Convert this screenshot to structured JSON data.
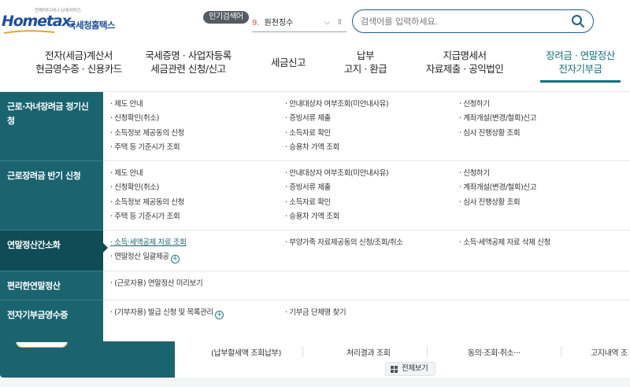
{
  "header": {
    "logo": {
      "tagline": "언제어디서나 납세서비스",
      "wordmark": "Hometax.",
      "title": "국세청홈택스"
    },
    "popular": {
      "badge": "인기검색어",
      "rank": "9.",
      "keyword": "원천징수",
      "chevron": "⌵",
      "pause": "II"
    },
    "search": {
      "placeholder": "검색어를 입력하세요."
    }
  },
  "nav": [
    {
      "line1": "전자(세금)계산서",
      "line2": "현금영수증 · 신용카드"
    },
    {
      "line1": "국세증명 · 사업자등록",
      "line2": "세금관련 신청/신고"
    },
    {
      "line1": "세금신고",
      "line2": ""
    },
    {
      "line1": "납부",
      "line2": "고지 · 환급"
    },
    {
      "line1": "지급명세서",
      "line2": "자료제출 · 공익법인"
    },
    {
      "line1": "장려금 · 연말정산",
      "line2": "전자기부금"
    }
  ],
  "dropdown": {
    "rows": [
      {
        "label": "근로·자녀장려금 정기신청",
        "col1": [
          "· 제도 안내",
          "· 신청확인(취소)",
          "· 소득정보 제공동의 신청",
          "· 주택 등 기준시가 조회"
        ],
        "col2": [
          "· 안내대상자 여부조회(미안내사유)",
          "· 증빙서류 제출",
          "· 소득자료 확인",
          "· 승용차 가액 조회"
        ],
        "col3": [
          "· 신청하기",
          "· 계좌개설(변경/철회)신고",
          "· 심사 진행상황 조회"
        ]
      },
      {
        "label": "근로장려금 반기 신청",
        "col1": [
          "· 제도 안내",
          "· 신청확인(취소)",
          "· 소득정보 제공동의 신청",
          "· 주택 등 기준시가 조회"
        ],
        "col2": [
          "· 안내대상자 여부조회(미안내사유)",
          "· 증빙서류 제출",
          "· 소득자료 확인",
          "· 승용차 가액 조회"
        ],
        "col3": [
          "· 신청하기",
          "· 계좌개설(변경/철회)신고",
          "· 심사 진행상황 조회"
        ]
      },
      {
        "label": "연말정산간소화",
        "col1": [
          "· 소득·세액공제 자료 조회",
          "· 연말정산 일괄제공"
        ],
        "col2": [
          "· 부양가족 자료제공동의 신청/조회/취소"
        ],
        "col3": [
          "· 소득·세액공제 자료 삭제 신청"
        ]
      },
      {
        "label": "편리한연말정산",
        "col1": [
          "· (근로자용) 연말정산 미리보기"
        ],
        "col2": [],
        "col3": []
      },
      {
        "label": "전자기부금영수증",
        "col1": [
          "· (기부자용) 발급 신청 및 목록관리"
        ],
        "col2": [
          "· 기부금 단체명 찾기"
        ],
        "col3": []
      }
    ]
  },
  "bottom": {
    "services": [
      "(납부할세액 조회납부)",
      "처리결과 조회",
      "동의·조회·취소···",
      "고지내역 조"
    ],
    "view_all": "전체보기"
  },
  "colors": {
    "brand_blue": "#1c4f9c",
    "teal": "#1a6470",
    "teal_dark": "#0f4c56",
    "accent_text": "#11717c",
    "rank_red": "#e0554a"
  }
}
